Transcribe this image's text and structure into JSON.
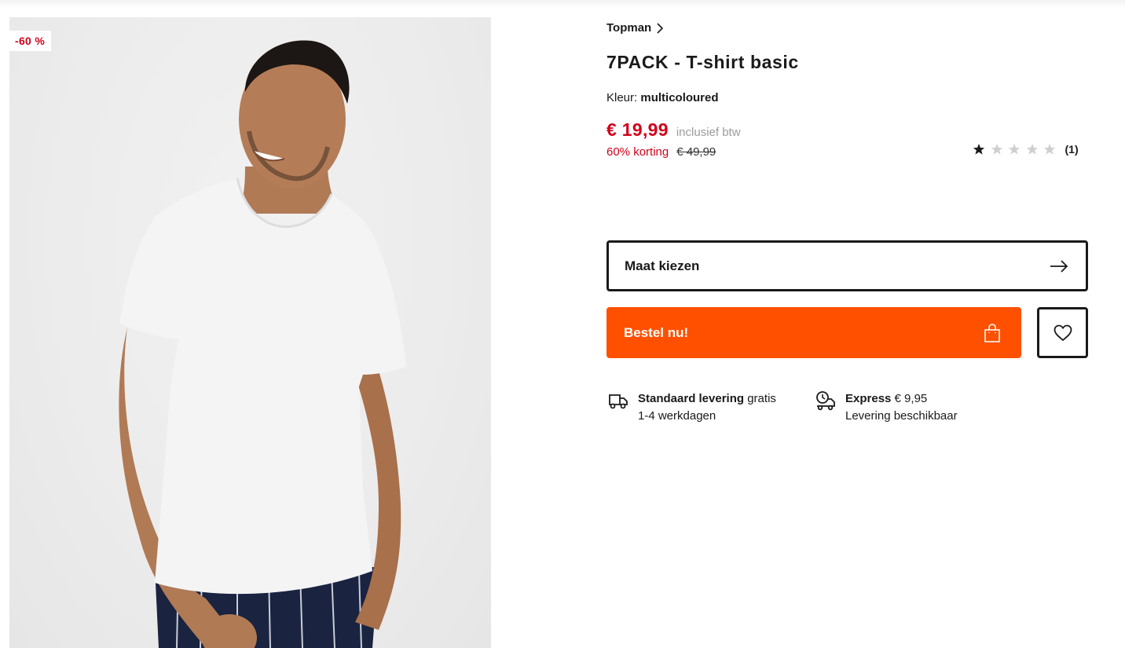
{
  "product_image": {
    "badge": "-60 %",
    "alt": "Model in white t-shirt"
  },
  "product": {
    "brand": "Topman",
    "title": "7PACK - T-shirt basic",
    "color_label": "Kleur:",
    "color_value": "multicoloured",
    "price": "€ 19,99",
    "vat_note": "inclusief btw",
    "discount_text": "60% korting",
    "original_price": "€ 49,99"
  },
  "rating": {
    "stars_filled": 1,
    "stars_total": 5,
    "count": "(1)"
  },
  "actions": {
    "size_label": "Maat kiezen",
    "order_label": "Bestel nu!"
  },
  "delivery": {
    "standard": {
      "title": "Standaard levering",
      "price": "gratis",
      "detail": "1-4 werkdagen"
    },
    "express": {
      "title": "Express",
      "price": "€ 9,95",
      "detail": "Levering beschikbaar"
    }
  },
  "colors": {
    "accent_orange": "#ff5000",
    "price_red": "#d0021b",
    "text_dark": "#1a1a1a"
  },
  "icons": {
    "brand_link": "chevron-right-icon",
    "size_select": "arrow-right-icon",
    "order": "shopping-bag-icon",
    "wishlist": "heart-icon",
    "standard_delivery": "truck-icon",
    "express_delivery": "express-delivery-icon"
  }
}
